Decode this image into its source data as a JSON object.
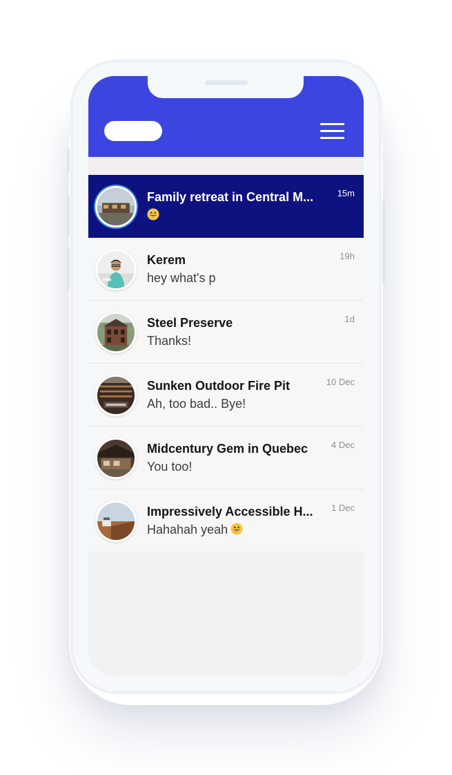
{
  "header": {
    "logo_icon": "app-logo-pill",
    "menu_icon": "hamburger-menu-icon",
    "color": "#3d45e0"
  },
  "conversations": [
    {
      "title": "Family retreat in Central M...",
      "preview": "",
      "emoji": "grinning-face-emoji",
      "time": "15m",
      "active": true,
      "avatar": "house-photo-avatar"
    },
    {
      "title": "Kerem",
      "preview": "hey what's p",
      "emoji": "",
      "time": "19h",
      "active": false,
      "avatar": "person-photo-avatar"
    },
    {
      "title": "Steel Preserve",
      "preview": "Thanks!",
      "emoji": "",
      "time": "1d",
      "active": false,
      "avatar": "house-photo-avatar"
    },
    {
      "title": "Sunken Outdoor Fire Pit",
      "preview": "Ah, too bad.. Bye!",
      "emoji": "",
      "time": "10 Dec",
      "active": false,
      "avatar": "house-photo-avatar"
    },
    {
      "title": "Midcentury Gem in Quebec",
      "preview": "You too!",
      "emoji": "",
      "time": "4 Dec",
      "active": false,
      "avatar": "house-photo-avatar"
    },
    {
      "title": "Impressively Accessible H...",
      "preview": "Hahahah yeah",
      "emoji": "grinning-face-emoji",
      "time": "1 Dec",
      "active": false,
      "avatar": "house-photo-avatar"
    }
  ],
  "colors": {
    "active_row": "#0e1280",
    "row_bg": "#f7f7f7",
    "accent_ring": "#3a8ce8"
  }
}
